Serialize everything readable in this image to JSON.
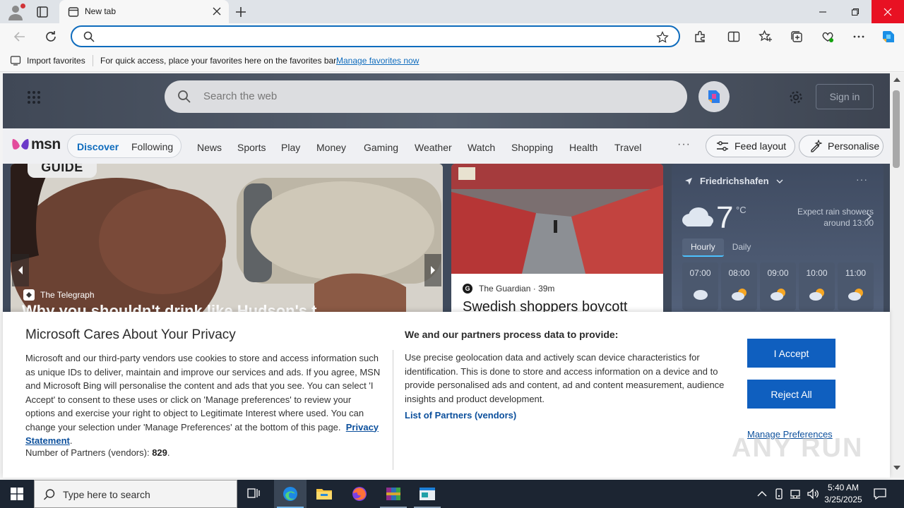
{
  "browser": {
    "tab_title": "New tab",
    "address_value": "",
    "favbar": {
      "import_label": "Import favorites",
      "message": "For quick access, place your favorites here on the favorites bar.",
      "manage_link": "Manage favorites now"
    }
  },
  "msn": {
    "search_placeholder": "Search the web",
    "sign_in": "Sign in",
    "logo_text": "msn",
    "nav": {
      "discover": "Discover",
      "following": "Following",
      "links": [
        "News",
        "Sports",
        "Play",
        "Money",
        "Gaming",
        "Weather",
        "Watch",
        "Shopping",
        "Health",
        "Travel"
      ],
      "more": "···",
      "feed_layout": "Feed layout",
      "personalise": "Personalise"
    },
    "hero": {
      "badge": "GUIDE",
      "source": "The Telegraph",
      "title": "Why you shouldn't drink like Hudson's t"
    },
    "card2": {
      "source": "The Guardian",
      "age": "39m",
      "title": "Swedish shoppers boycott"
    },
    "weather": {
      "location": "Friedrichshafen",
      "temp": "7",
      "unit": "°C",
      "forecast_line1": "Expect rain showers",
      "forecast_line2": "around 13:00",
      "tab_hourly": "Hourly",
      "tab_daily": "Daily",
      "hours": [
        "07:00",
        "08:00",
        "09:00",
        "10:00",
        "11:00"
      ],
      "more": "···"
    }
  },
  "privacy": {
    "title": "Microsoft Cares About Your Privacy",
    "body": "Microsoft and our third-party vendors use cookies to store and access information such as unique IDs to deliver, maintain and improve our services and ads. If you agree, MSN and Microsoft Bing will personalise the content and ads that you see. You can select 'I Accept' to consent to these uses or click on 'Manage preferences' to review your options and exercise your right to object to Legitimate Interest where used.  You can change your selection under 'Manage Preferences' at the bottom of this page.",
    "privacy_link": "Privacy Statement",
    "partners_label": "Number of Partners (vendors):",
    "partners_count": "829",
    "subtitle": "We and our partners process data to provide:",
    "body2": "Use precise geolocation data and actively scan device characteristics for identification. This is done to store and access information on a device and to provide personalised ads and content, ad and content measurement, audience insights and product development.",
    "partners_link": "List of Partners (vendors)",
    "accept": "I Accept",
    "reject": "Reject All",
    "manage": "Manage Preferences",
    "watermark": "ANY RUN"
  },
  "taskbar": {
    "search_placeholder": "Type here to search",
    "time": "5:40 AM",
    "date": "3/25/2025"
  }
}
